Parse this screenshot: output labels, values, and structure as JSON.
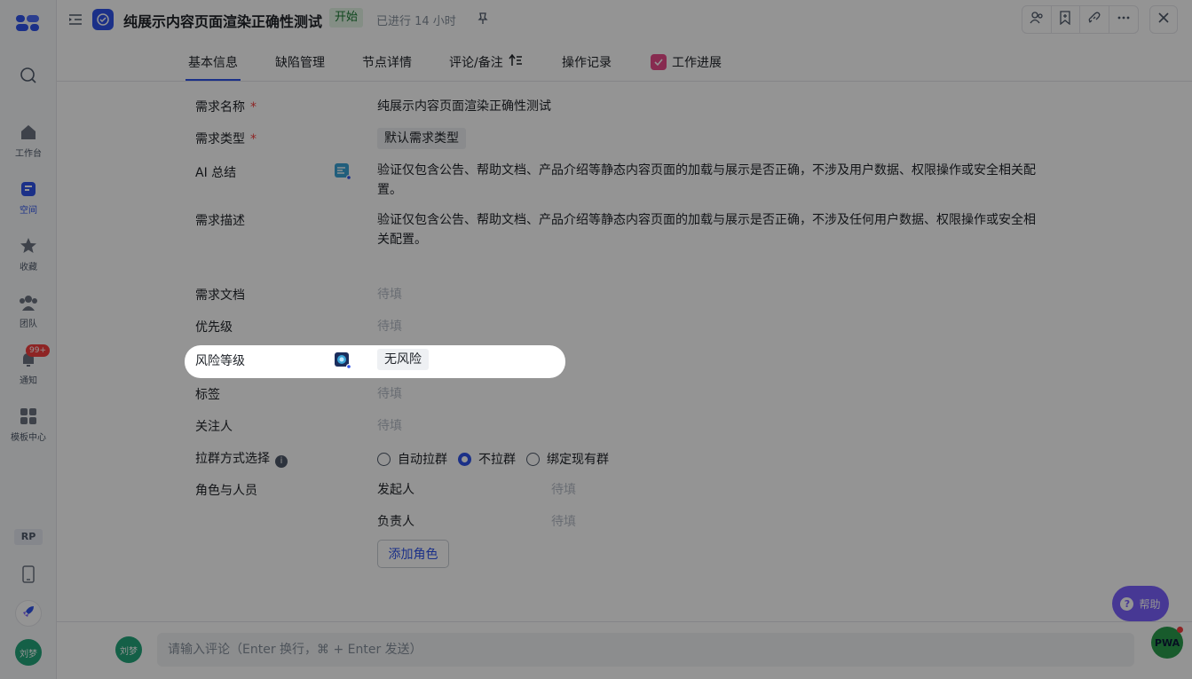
{
  "sidebar": {
    "items": [
      {
        "label": "",
        "icon": "search-icon"
      },
      {
        "label": "工作台",
        "icon": "home-icon"
      },
      {
        "label": "空间",
        "icon": "space-icon",
        "active": true
      },
      {
        "label": "收藏",
        "icon": "star-icon"
      },
      {
        "label": "团队",
        "icon": "team-icon"
      },
      {
        "label": "通知",
        "icon": "bell-icon",
        "badge": "99+"
      },
      {
        "label": "模板中心",
        "icon": "template-icon"
      }
    ],
    "workspace_badge": "RP",
    "user_avatar": "刘梦"
  },
  "header": {
    "title": "纯展示内容页面渲染正确性测试",
    "status": "开始",
    "elapsed": "已进行 14 小时"
  },
  "tabs": [
    {
      "label": "基本信息",
      "active": true
    },
    {
      "label": "缺陷管理"
    },
    {
      "label": "节点详情"
    },
    {
      "label": "评论/备注"
    },
    {
      "label": "操作记录"
    },
    {
      "label": "工作进展"
    }
  ],
  "fields": {
    "name": {
      "label": "需求名称",
      "required": "*",
      "value": "纯展示内容页面渲染正确性测试"
    },
    "type": {
      "label": "需求类型",
      "required": "*",
      "value": "默认需求类型"
    },
    "ai_summary": {
      "label": "AI 总结",
      "value": "验证仅包含公告、帮助文档、产品介绍等静态内容页面的加载与展示是否正确，不涉及用户数据、权限操作或安全相关配置。"
    },
    "description": {
      "label": "需求描述",
      "value": "验证仅包含公告、帮助文档、产品介绍等静态内容页面的加载与展示是否正确，不涉及任何用户数据、权限操作或安全相关配置。"
    },
    "document": {
      "label": "需求文档",
      "value": "待填"
    },
    "priority": {
      "label": "优先级",
      "value": "待填"
    },
    "risk": {
      "label": "风险等级",
      "value": "无风险"
    },
    "tags": {
      "label": "标签",
      "value": "待填"
    },
    "followers": {
      "label": "关注人",
      "value": "待填"
    },
    "group_mode": {
      "label": "拉群方式选择",
      "options": [
        "自动拉群",
        "不拉群",
        "绑定现有群"
      ],
      "selected": "不拉群"
    },
    "roles": {
      "label": "角色与人员",
      "items": [
        {
          "role": "发起人",
          "value": "待填"
        },
        {
          "role": "负责人",
          "value": "待填"
        }
      ],
      "add_button": "添加角色"
    }
  },
  "comment": {
    "avatar": "刘梦",
    "placeholder": "请输入评论（Enter 换行，⌘ + Enter 发送）"
  },
  "help_button": "帮助",
  "pwa_label": "PWA",
  "colors": {
    "accent": "#2f54eb",
    "status_bg": "#e3f4e6",
    "required": "#f53f3f",
    "help": "#7b61ff"
  }
}
